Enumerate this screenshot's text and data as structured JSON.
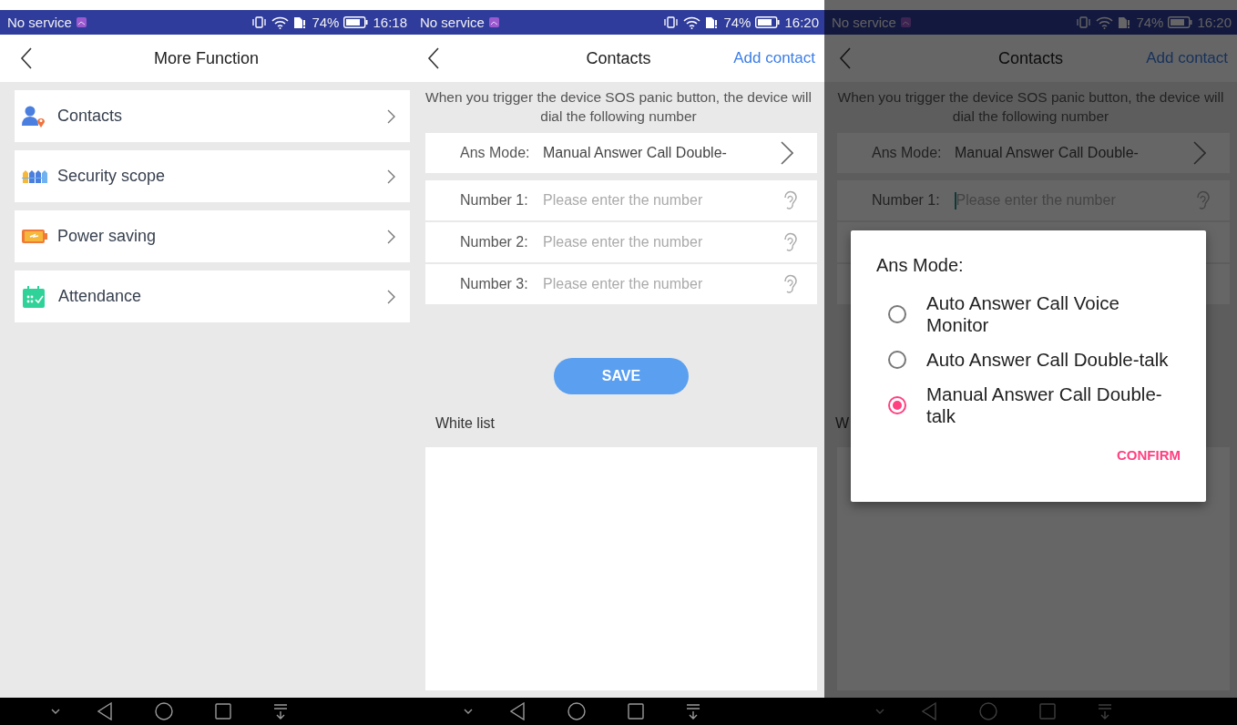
{
  "screen_1": {
    "status_bar": {
      "carrier": "No service",
      "battery": "74%",
      "time": "16:18"
    },
    "header": {
      "title": "More Function"
    },
    "menu_items": [
      {
        "label": "Contacts"
      },
      {
        "label": "Security scope"
      },
      {
        "label": "Power saving"
      },
      {
        "label": "Attendance"
      }
    ]
  },
  "screen_2": {
    "status_bar": {
      "carrier": "No service",
      "battery": "74%",
      "time": "16:20"
    },
    "header": {
      "title": "Contacts",
      "action": "Add contact"
    },
    "notice": "When you trigger the device SOS panic button, the device will dial the following number",
    "ans_mode": {
      "label": "Ans Mode:",
      "value": "Manual Answer Call Double-"
    },
    "numbers": [
      {
        "label": "Number 1:",
        "placeholder": "Please enter the number",
        "focused": false
      },
      {
        "label": "Number 2:",
        "placeholder": "Please enter the number",
        "focused": false
      },
      {
        "label": "Number 3:",
        "placeholder": "Please enter the number",
        "focused": false
      }
    ],
    "save_button": "SAVE",
    "white_list": {
      "title": "White list"
    }
  },
  "screen_3": {
    "status_bar": {
      "carrier": "No service",
      "battery": "74%",
      "time": "16:20"
    },
    "header": {
      "title": "Contacts",
      "action": "Add contact"
    },
    "notice": "When you trigger the device SOS panic button, the device will dial the following number",
    "ans_mode": {
      "label": "Ans Mode:",
      "value": "Manual Answer Call Double-"
    },
    "numbers": [
      {
        "label": "Number 1:",
        "placeholder": "Please enter the number",
        "focused": true
      }
    ],
    "white_list": {
      "title": "W"
    },
    "dialog": {
      "title": "Ans Mode:",
      "options": [
        {
          "label": "Auto Answer Call Voice Monitor",
          "selected": false
        },
        {
          "label": "Auto Answer Call Double-talk",
          "selected": false
        },
        {
          "label": "Manual Answer Call Double-talk",
          "selected": true
        }
      ],
      "confirm": "CONFIRM"
    }
  }
}
